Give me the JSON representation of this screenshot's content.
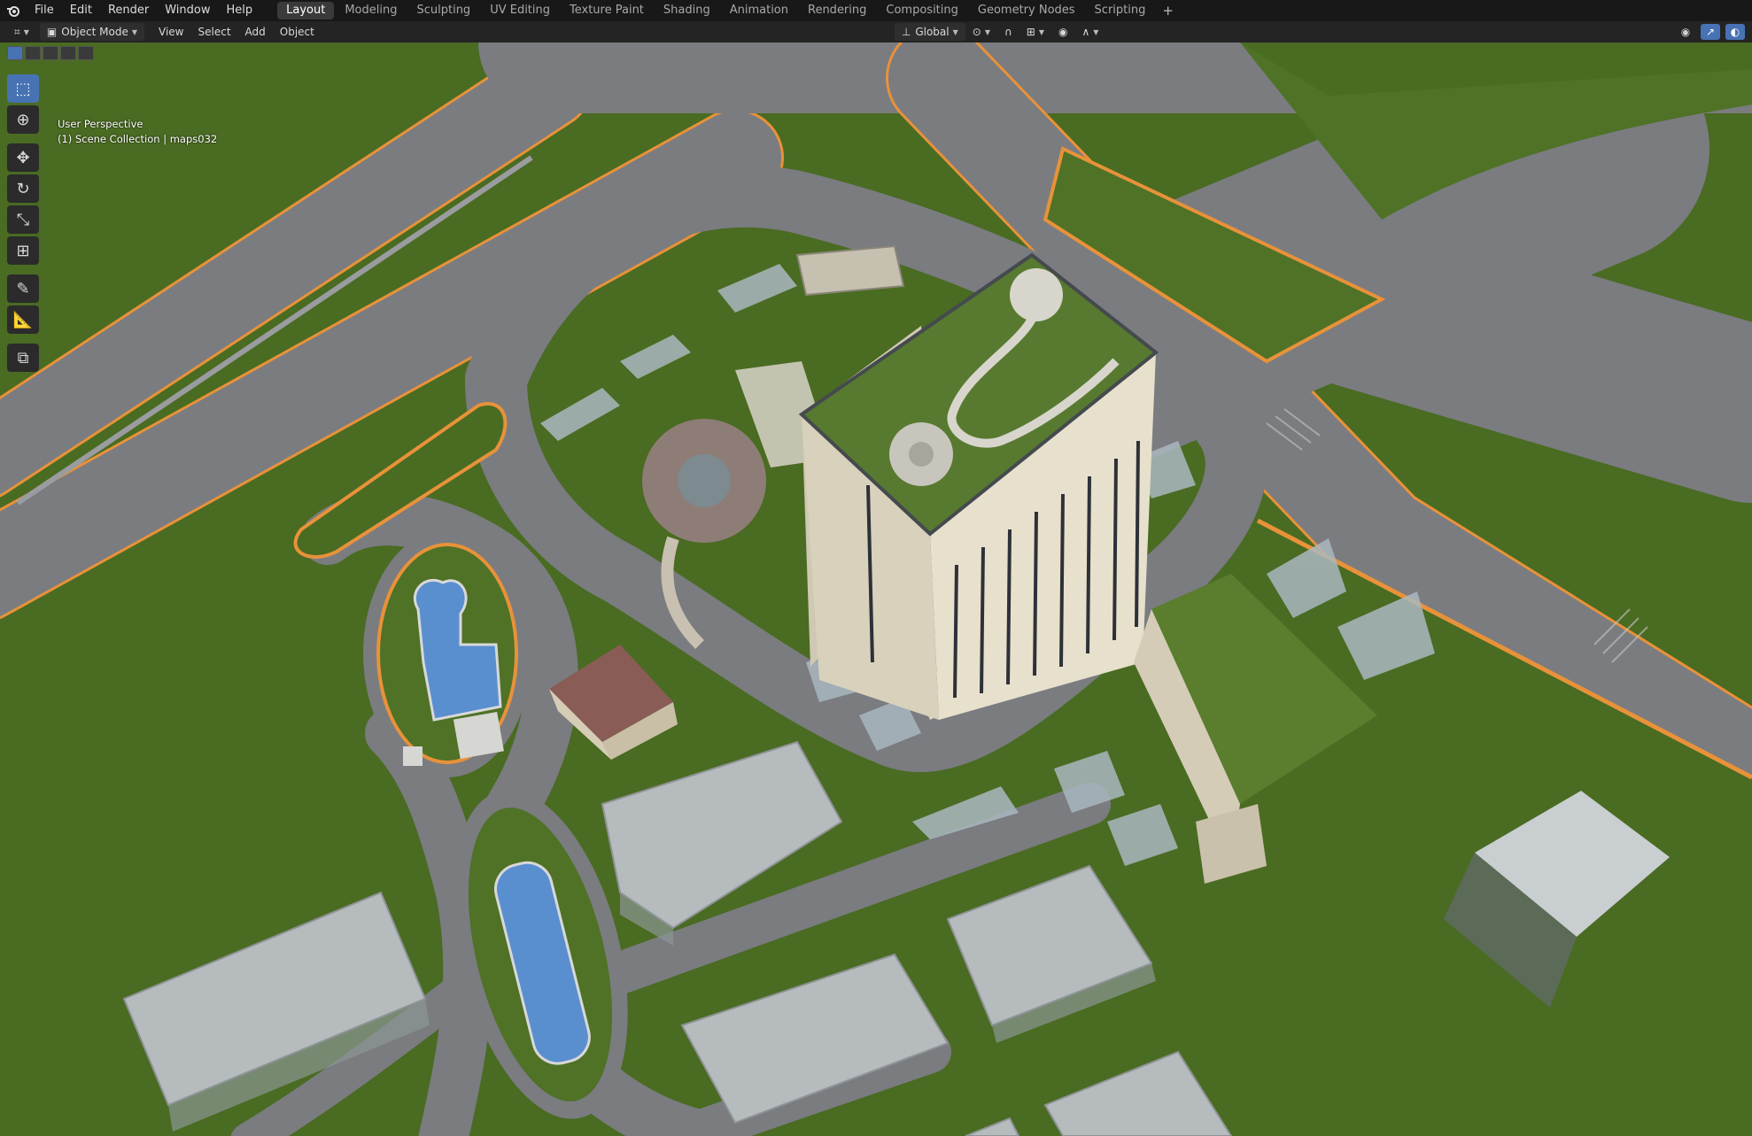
{
  "menubar": {
    "menus": [
      "File",
      "Edit",
      "Render",
      "Window",
      "Help"
    ],
    "workspaces": [
      "Layout",
      "Modeling",
      "Sculpting",
      "UV Editing",
      "Texture Paint",
      "Shading",
      "Animation",
      "Rendering",
      "Compositing",
      "Geometry Nodes",
      "Scripting"
    ],
    "active_workspace": "Layout",
    "add_workspace": "+"
  },
  "header": {
    "mode": "Object Mode",
    "menus": [
      "View",
      "Select",
      "Add",
      "Object"
    ],
    "transform_orientation": "Global"
  },
  "viewport": {
    "perspective_label": "User Perspective",
    "collection_label": "(1) Scene Collection | maps032"
  },
  "colors": {
    "grass": "#4a6b22",
    "road": "#7a7c80",
    "road_edge": "#e8923a",
    "water": "#5a8fcf",
    "building": "#d9d2bd",
    "accent": "#4772b3"
  },
  "icons": {
    "tools": [
      "select-box-icon",
      "cursor-icon",
      "move-icon",
      "rotate-icon",
      "scale-icon",
      "transform-icon",
      "annotate-icon",
      "measure-icon",
      "add-cube-icon"
    ]
  }
}
